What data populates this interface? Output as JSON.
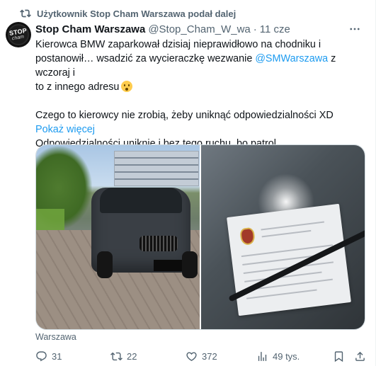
{
  "retweet": {
    "label": "Użytkownik Stop Cham Warszawa podał dalej"
  },
  "author": {
    "name": "Stop Cham Warszawa",
    "handle": "@Stop_Cham_W_wa",
    "separator": "·",
    "time": "11 cze",
    "avatar_top": "STOP",
    "avatar_bottom": "cham"
  },
  "tweet": {
    "line1": "Kierowca BMW zaparkował dzisiaj nieprawidłowo na chodniku i",
    "line2a": "postanowił… wsadzić za wycieraczkę wezwanie ",
    "mention": "@SMWarszawa",
    "line2b": " z wczoraj i",
    "line3": "to z innego adresu",
    "para2": "Czego to kierowcy nie zrobią, żeby uniknąć odpowiedzialności XD",
    "para3": "Odpowiedzialności uniknie i bez tego ruchu, bo patrol…",
    "show_more": "Pokaż więcej"
  },
  "location": "Warszawa",
  "actions": {
    "replies": "31",
    "reposts": "22",
    "likes": "372",
    "views": "49 tys."
  },
  "colors": {
    "accent": "#1d9bf0",
    "secondary_text": "#536471",
    "primary_text": "#0f1419",
    "border": "#cfd9de"
  },
  "icons": [
    "retweet-icon",
    "more-icon",
    "reply-icon",
    "repost-icon",
    "like-icon",
    "views-icon",
    "bookmark-icon",
    "share-icon"
  ]
}
